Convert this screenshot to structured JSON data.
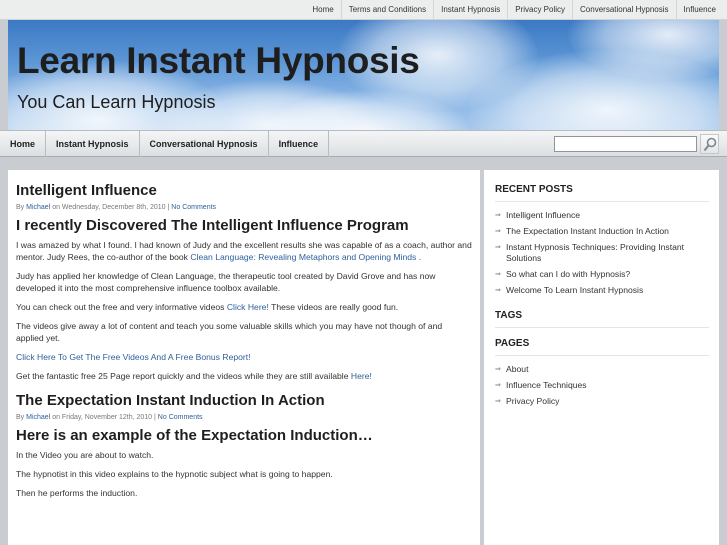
{
  "top_nav": {
    "items": [
      "Home",
      "Terms and Conditions",
      "Instant Hypnosis",
      "Privacy Policy",
      "Conversational Hypnosis",
      "Influence"
    ]
  },
  "header": {
    "title": "Learn Instant Hypnosis",
    "tagline": "You Can Learn Hypnosis"
  },
  "main_nav": {
    "items": [
      "Home",
      "Instant Hypnosis",
      "Conversational Hypnosis",
      "Influence"
    ]
  },
  "search": {
    "value": "",
    "placeholder": ""
  },
  "posts": [
    {
      "title": "Intelligent Influence",
      "meta_by": "By",
      "author": "Michael",
      "meta_date": "on Wednesday, December 8th, 2010 |",
      "comments": "No Comments",
      "heading": "I recently Discovered The Intelligent Influence Program",
      "p1_text": "I was amazed by what I found. I had known of Judy and the excellent results she was capable of as a coach, author and mentor. Judy Rees, the co-author of the book ",
      "p1_link": "Clean Language: Revealing Metaphors and Opening Minds",
      "p1_tail": " .",
      "p2": "Judy has applied her knowledge of Clean Language, the therapeutic tool created by David Grove and has now developed it into the most comprehensive influence toolbox available.",
      "p3_text": "You can check out the free and very informative videos ",
      "p3_link": "Click Here!",
      "p3_tail": " These videos are really good fun.",
      "p4": "The videos give away a lot of content and teach you some valuable skills which you may have not though of and applied yet.",
      "cta_link": "Click Here To Get The Free Videos And A Free Bonus Report!",
      "p5_text": "Get the fantastic free 25 Page report quickly and the videos while they are still available ",
      "p5_link": "Here!"
    },
    {
      "title": "The Expectation Instant Induction In Action",
      "meta_by": "By",
      "author": "Michael",
      "meta_date": "on Friday, November 12th, 2010 |",
      "comments": "No Comments",
      "heading": "Here is an example of the Expectation Induction…",
      "p1": "In the Video you are about to watch.",
      "p2": "The hypnotist in this video explains to the hypnotic subject what is going to happen.",
      "p3": "Then he performs the induction."
    }
  ],
  "sidebar": {
    "recent_posts_title": "RECENT POSTS",
    "recent_posts": [
      "Intelligent Influence",
      "The Expectation Instant Induction In Action",
      "Instant Hypnosis Techniques: Providing Instant Solutions",
      "So what can I do with Hypnosis?",
      "Welcome To Learn Instant Hypnosis"
    ],
    "tags_title": "TAGS",
    "pages_title": "PAGES",
    "pages": [
      "About",
      "Influence Techniques",
      "Privacy Policy"
    ],
    "bullet": "⇒"
  },
  "icons": {
    "search": "magnifier-icon"
  }
}
